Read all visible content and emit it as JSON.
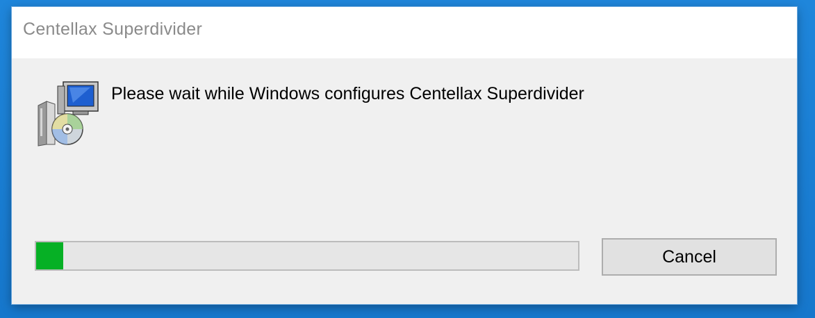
{
  "window": {
    "title": "Centellax Superdivider"
  },
  "content": {
    "icon": "installer-package-icon",
    "message": "Please wait while Windows configures Centellax Superdivider"
  },
  "progress": {
    "fraction": 0.05,
    "fill_color": "#06b025"
  },
  "buttons": {
    "cancel_label": "Cancel"
  },
  "colors": {
    "desktop_accent": "#1a7fd6"
  }
}
